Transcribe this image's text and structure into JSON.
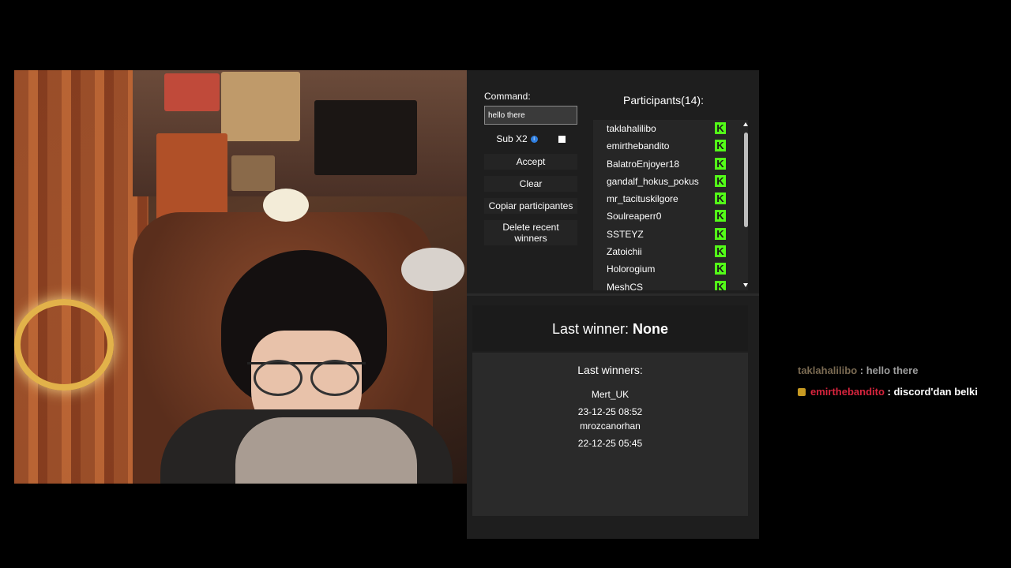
{
  "widget": {
    "command_label": "Command:",
    "command_value": "hello there",
    "sub_label": "Sub X2",
    "buttons": {
      "accept": "Accept",
      "clear": "Clear",
      "copy": "Copiar participantes",
      "delete_line1": "Delete recent",
      "delete_line2": "winners"
    },
    "participants_title": "Participants(14):",
    "participants": [
      "taklahalilibo",
      "emirthebandito",
      "BalatroEnjoyer18",
      "gandalf_hokus_pokus",
      "mr_tacituskilgore",
      "Soulreaperr0",
      "SSTEYZ",
      "Zatoichii",
      "Holorogium",
      "MeshCS"
    ],
    "last_winner_label": "Last winner: ",
    "last_winner_value": "None",
    "last_winners_title": "Last winners:",
    "last_winners": [
      {
        "name": "Mert_UK",
        "date": "23-12-25 08:52"
      },
      {
        "name": "mrozcanorhan",
        "date": "22-12-25 05:45"
      }
    ]
  },
  "chat": [
    {
      "user": "taklahalilibo",
      "sep": " : ",
      "text": "hello there"
    },
    {
      "user": "emirthebandito",
      "sep": " : ",
      "text": "discord'dan belki"
    }
  ],
  "colors": {
    "kick_green": "#53fc18",
    "info_blue": "#2f7fe0",
    "chat_user1": "#7a6a52",
    "chat_user2": "#d7243d"
  }
}
